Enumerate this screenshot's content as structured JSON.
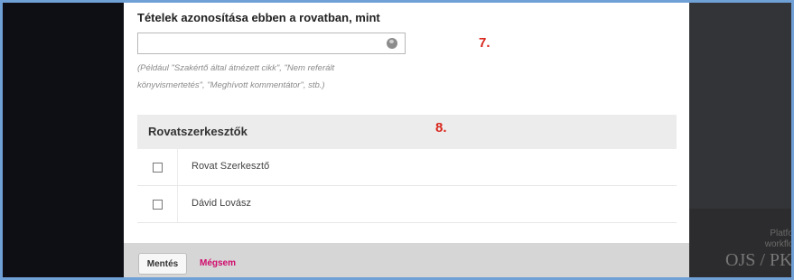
{
  "form": {
    "identify_label": "Tételek azonosítása ebben a rovatban, mint",
    "identify_value": "",
    "hint_line1": "(Például \"Szakértő által átnézett cikk\", \"Nem referált",
    "hint_line2": "könyvismertetés\", \"Meghívott kommentátor\", stb.)",
    "globe_icon": "globe-icon"
  },
  "markers": {
    "m7": "7.",
    "m8": "8."
  },
  "section_editors": {
    "title": "Rovatszerkesztők",
    "items": [
      {
        "name": "Rovat Szerkesztő",
        "checked": false
      },
      {
        "name": "Dávid Lovász",
        "checked": false
      }
    ]
  },
  "actions": {
    "save_label": "Mentés",
    "cancel_label": "Mégsem"
  },
  "footer": {
    "line1": "Platform &",
    "line2": "workflow by",
    "logo": "OJS / PKP"
  },
  "colors": {
    "accent_link": "#d00a6c",
    "marker": "#d9261c",
    "border": "#6fa0d6"
  }
}
